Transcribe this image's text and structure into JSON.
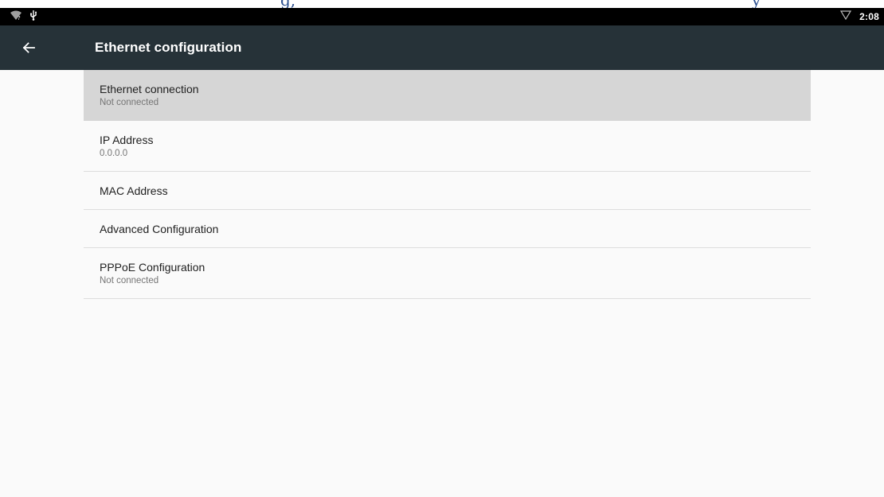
{
  "top_fragment": {
    "left_text": "g,",
    "right_text": "y"
  },
  "status_bar": {
    "left_icons": [
      "wifi-unknown-icon",
      "usb-icon"
    ],
    "right_icons": [
      "signal-triangle-icon"
    ],
    "clock": "2:08"
  },
  "app_bar": {
    "back_icon": "arrow-back-icon",
    "title": "Ethernet configuration",
    "color": "#263238"
  },
  "list": {
    "items": [
      {
        "title": "Ethernet connection",
        "summary": "Not connected",
        "selected": true
      },
      {
        "title": "IP Address",
        "summary": "0.0.0.0"
      },
      {
        "title": "MAC Address"
      },
      {
        "title": "Advanced Configuration"
      },
      {
        "title": "PPPoE Configuration",
        "summary": "Not connected"
      }
    ]
  },
  "colors": {
    "background": "#fafafa",
    "selected_row": "#d6d6d6",
    "status_bar": "#000000",
    "fragment_text": "#2b4f8f"
  }
}
